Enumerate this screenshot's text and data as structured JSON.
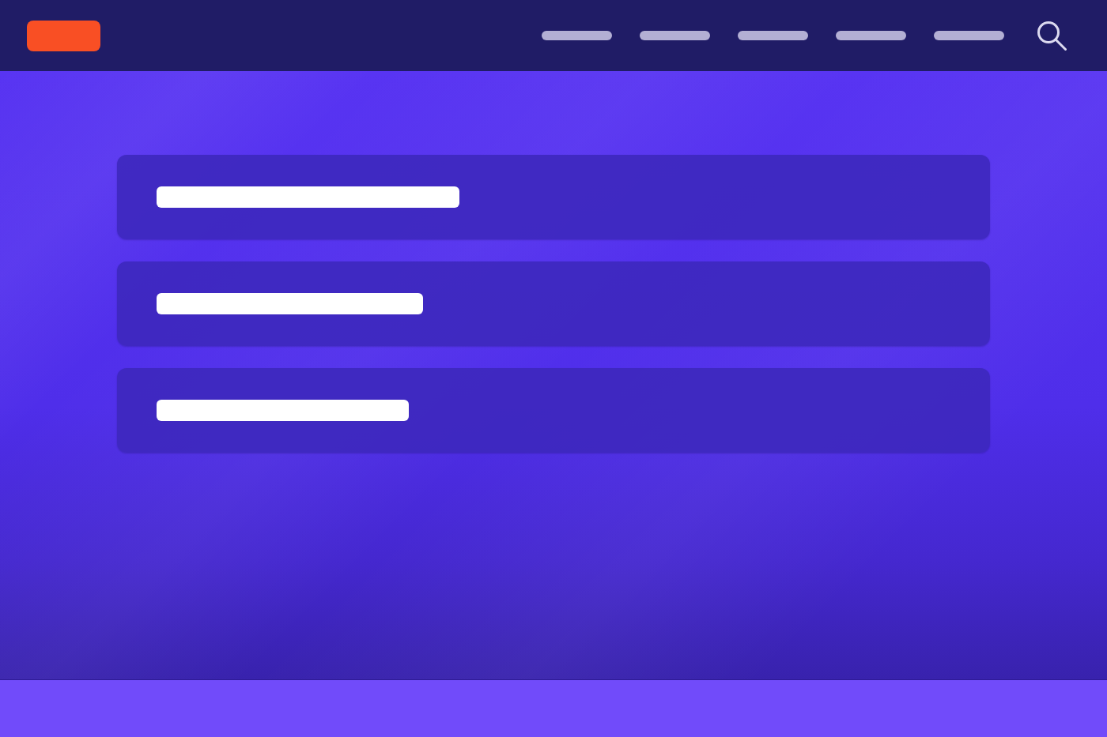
{
  "header": {
    "logo": {
      "kind": "block"
    },
    "nav_links": [
      {
        "kind": "placeholder"
      },
      {
        "kind": "placeholder"
      },
      {
        "kind": "placeholder"
      },
      {
        "kind": "placeholder"
      },
      {
        "kind": "placeholder"
      }
    ],
    "search": {
      "kind": "magnifier"
    }
  },
  "cards": [
    {
      "kind": "placeholder"
    },
    {
      "kind": "placeholder"
    },
    {
      "kind": "placeholder"
    }
  ],
  "footer": {
    "kind": "band"
  }
}
